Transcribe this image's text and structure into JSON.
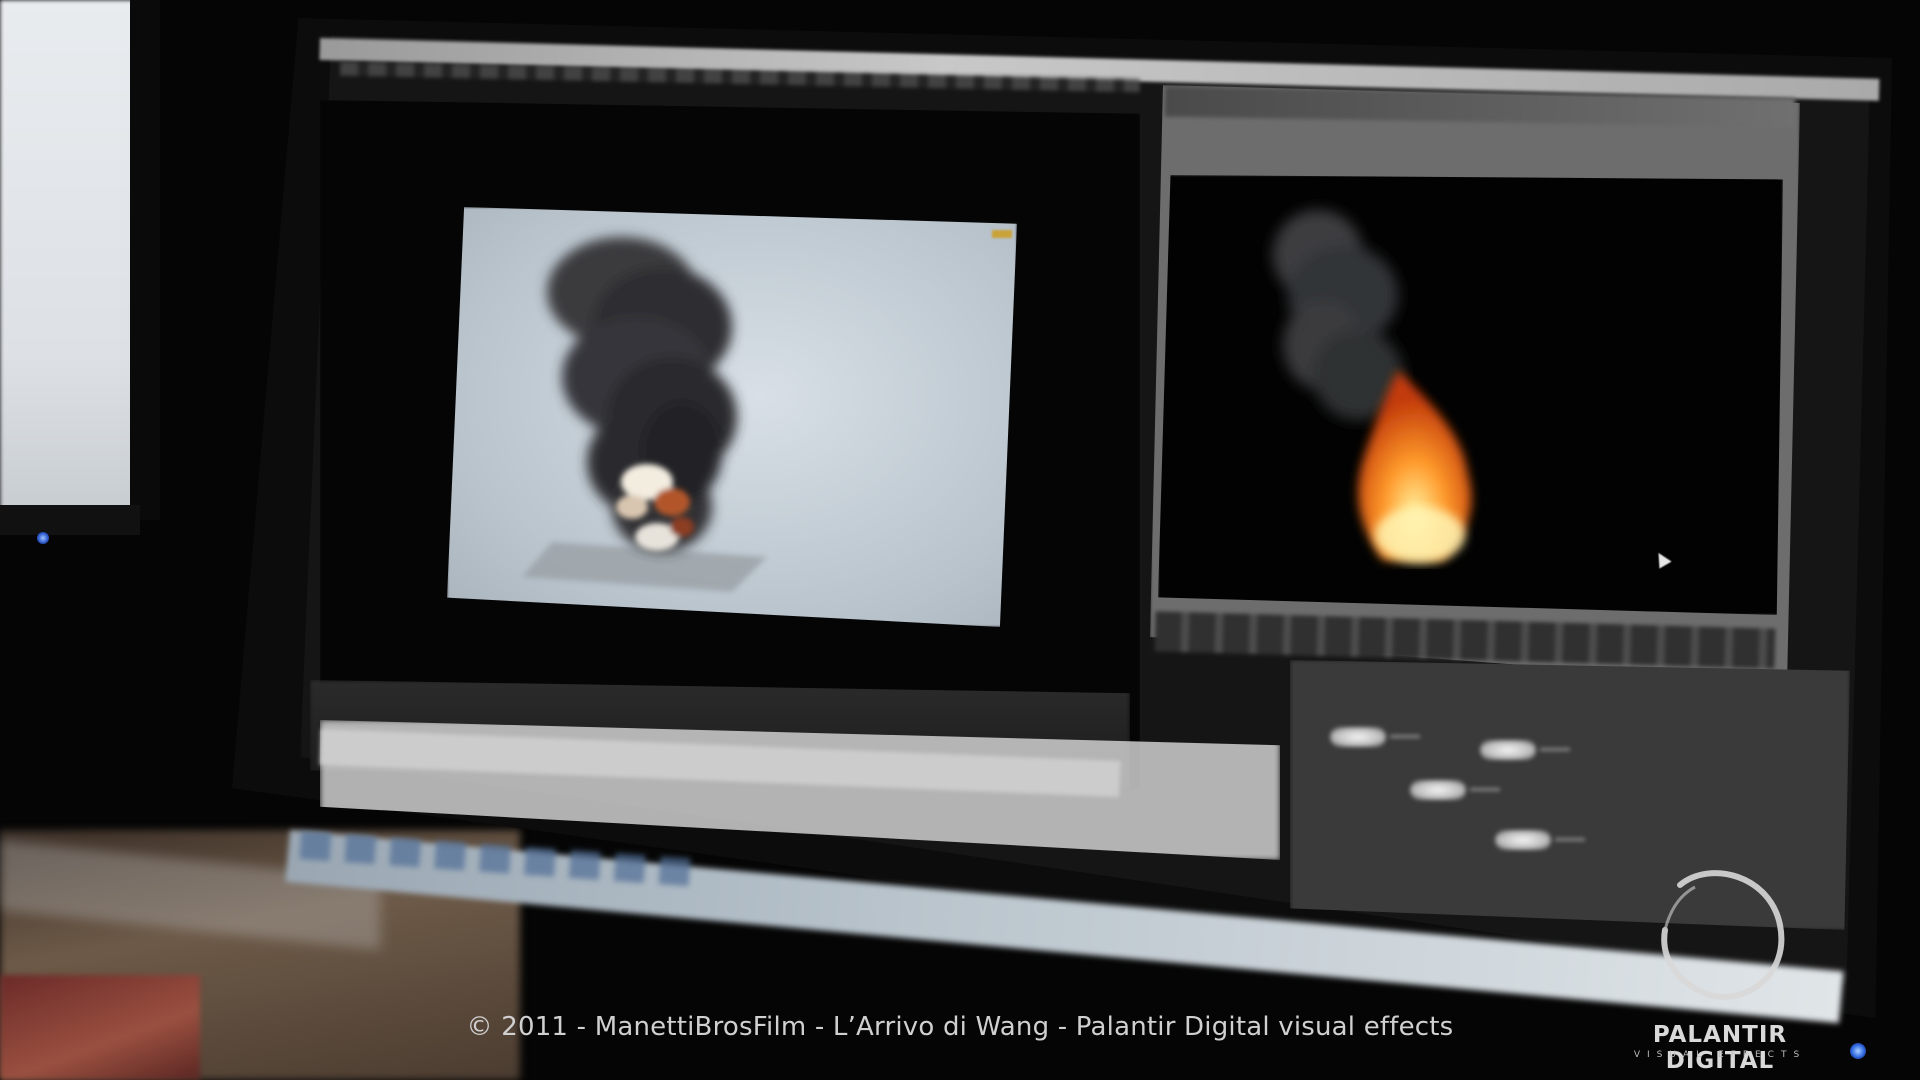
{
  "caption": "© 2011 - ManettiBrosFilm - L’Arrivo di Wang - Palantir Digital visual effects",
  "logo": {
    "name": "PALANTIR DIGITAL",
    "tagline": "VISUAL EFFECTS"
  },
  "colors": {
    "render_background": "#c2ccd4",
    "smoke": "#2f3033",
    "fire_core": "#fff2a0",
    "fire_mid": "#ff9a2a",
    "fire_edge": "#c23a0a",
    "status_led": "#2f66e0"
  },
  "icons": {
    "cursor": "arrow-cursor-icon",
    "logo_mark": "ring-logo-icon"
  }
}
